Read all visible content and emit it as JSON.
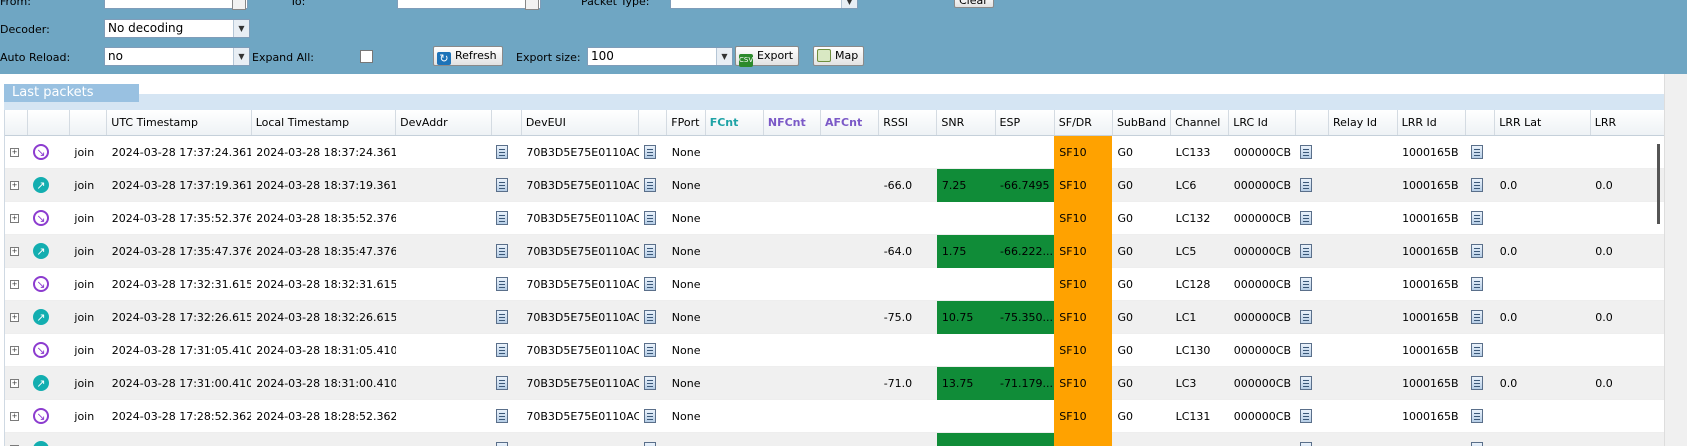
{
  "filters": {
    "from_label": "From:",
    "to_label": "To:",
    "packet_type_label": "Packet Type:",
    "clear_label": "Clear",
    "decoder_label": "Decoder:",
    "decoder_value": "No decoding",
    "auto_reload_label": "Auto Reload:",
    "auto_reload_value": "no",
    "expand_all_label": "Expand All:",
    "expand_all_checked": false,
    "refresh_label": "Refresh",
    "export_size_label": "Export size:",
    "export_size_value": "100",
    "export_label": "Export",
    "map_label": "Map"
  },
  "panel": {
    "title": "Last packets"
  },
  "columns": [
    "",
    "",
    "",
    "UTC Timestamp",
    "Local Timestamp",
    "DevAddr",
    "",
    "DevEUI",
    "",
    "FPort",
    "FCnt",
    "NFCnt",
    "AFCnt",
    "RSSI",
    "SNR",
    "ESP",
    "SF/DR",
    "SubBand",
    "Channel",
    "LRC Id",
    "",
    "Relay Id",
    "LRR Id",
    "",
    "LRR Lat",
    "LRR"
  ],
  "rows": [
    {
      "direction": "down",
      "type": "join",
      "utc": "2024-03-28 17:37:24.361",
      "local": "2024-03-28 18:37:24.361",
      "deveui": "70B3D5E75E0110AC",
      "fport": "None",
      "rssi": "",
      "snr": "",
      "esp": "",
      "sf": "SF10",
      "subband": "G0",
      "channel": "LC133",
      "lrc": "000000CB",
      "lrr": "1000165B",
      "lat": "",
      "lrr2": ""
    },
    {
      "direction": "up",
      "type": "join",
      "utc": "2024-03-28 17:37:19.361",
      "local": "2024-03-28 18:37:19.361",
      "deveui": "70B3D5E75E0110AC",
      "fport": "None",
      "rssi": "-66.0",
      "snr": "7.25",
      "esp": "-66.7495",
      "sf": "SF10",
      "subband": "G0",
      "channel": "LC6",
      "lrc": "000000CB",
      "lrr": "1000165B",
      "lat": "0.0",
      "lrr2": "0.0"
    },
    {
      "direction": "down",
      "type": "join",
      "utc": "2024-03-28 17:35:52.376",
      "local": "2024-03-28 18:35:52.376",
      "deveui": "70B3D5E75E0110AC",
      "fport": "None",
      "rssi": "",
      "snr": "",
      "esp": "",
      "sf": "SF10",
      "subband": "G0",
      "channel": "LC132",
      "lrc": "000000CB",
      "lrr": "1000165B",
      "lat": "",
      "lrr2": ""
    },
    {
      "direction": "up",
      "type": "join",
      "utc": "2024-03-28 17:35:47.376",
      "local": "2024-03-28 18:35:47.376",
      "deveui": "70B3D5E75E0110AC",
      "fport": "None",
      "rssi": "-64.0",
      "snr": "1.75",
      "esp": "-66.222...",
      "sf": "SF10",
      "subband": "G0",
      "channel": "LC5",
      "lrc": "000000CB",
      "lrr": "1000165B",
      "lat": "0.0",
      "lrr2": "0.0"
    },
    {
      "direction": "down",
      "type": "join",
      "utc": "2024-03-28 17:32:31.615",
      "local": "2024-03-28 18:32:31.615",
      "deveui": "70B3D5E75E0110AC",
      "fport": "None",
      "rssi": "",
      "snr": "",
      "esp": "",
      "sf": "SF10",
      "subband": "G0",
      "channel": "LC128",
      "lrc": "000000CB",
      "lrr": "1000165B",
      "lat": "",
      "lrr2": ""
    },
    {
      "direction": "up",
      "type": "join",
      "utc": "2024-03-28 17:32:26.615",
      "local": "2024-03-28 18:32:26.615",
      "deveui": "70B3D5E75E0110AC",
      "fport": "None",
      "rssi": "-75.0",
      "snr": "10.75",
      "esp": "-75.350...",
      "sf": "SF10",
      "subband": "G0",
      "channel": "LC1",
      "lrc": "000000CB",
      "lrr": "1000165B",
      "lat": "0.0",
      "lrr2": "0.0"
    },
    {
      "direction": "down",
      "type": "join",
      "utc": "2024-03-28 17:31:05.410",
      "local": "2024-03-28 18:31:05.410",
      "deveui": "70B3D5E75E0110AC",
      "fport": "None",
      "rssi": "",
      "snr": "",
      "esp": "",
      "sf": "SF10",
      "subband": "G0",
      "channel": "LC130",
      "lrc": "000000CB",
      "lrr": "1000165B",
      "lat": "",
      "lrr2": ""
    },
    {
      "direction": "up",
      "type": "join",
      "utc": "2024-03-28 17:31:00.410",
      "local": "2024-03-28 18:31:00.410",
      "deveui": "70B3D5E75E0110AC",
      "fport": "None",
      "rssi": "-71.0",
      "snr": "13.75",
      "esp": "-71.179...",
      "sf": "SF10",
      "subband": "G0",
      "channel": "LC3",
      "lrc": "000000CB",
      "lrr": "1000165B",
      "lat": "0.0",
      "lrr2": "0.0"
    },
    {
      "direction": "down",
      "type": "join",
      "utc": "2024-03-28 17:28:52.362",
      "local": "2024-03-28 18:28:52.362",
      "deveui": "70B3D5E75E0110AC",
      "fport": "None",
      "rssi": "",
      "snr": "",
      "esp": "",
      "sf": "SF10",
      "subband": "G0",
      "channel": "LC131",
      "lrc": "000000CB",
      "lrr": "1000165B",
      "lat": "",
      "lrr2": ""
    },
    {
      "direction": "up",
      "type": "",
      "utc": "",
      "local": "",
      "deveui": "",
      "fport": "",
      "rssi": "",
      "snr": "",
      "esp": "",
      "sf": "",
      "subband": "",
      "channel": "",
      "lrc": "",
      "lrr": "",
      "lat": "",
      "lrr2": ""
    }
  ],
  "icons": {
    "direction_down": "arrow-down-right-icon",
    "direction_up": "arrow-up-right-icon",
    "detail": "document-icon",
    "expand": "expand-plus-icon"
  },
  "colors": {
    "filter_bg": "#6fa6c3",
    "snr_good": "#108c38",
    "sf_highlight": "#ffa200"
  }
}
